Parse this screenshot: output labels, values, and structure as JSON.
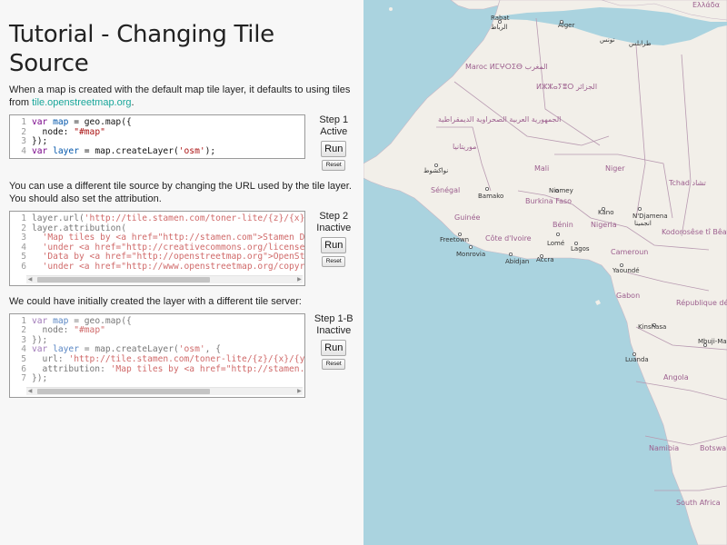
{
  "tutorial": {
    "title": "Tutorial - Changing Tile Source",
    "intro_text": "When a map is created with the default map tile layer, it defaults to using tiles from ",
    "intro_link": "tile.openstreetmap.org",
    "intro_end": ".",
    "step2_text": "You can use a different tile source by changing the URL used by the tile layer. You should also set the attribution.",
    "step1b_text": "We could have initially created the layer with a different tile server:"
  },
  "steps": [
    {
      "label": "Step 1",
      "status": "Active",
      "run_label": "Run",
      "reset_label": "Reset",
      "code_lines": [
        "var map = geo.map({",
        "  node: \"#map\"",
        "});",
        "var layer = map.createLayer('osm');"
      ]
    },
    {
      "label": "Step 2",
      "status": "Inactive",
      "run_label": "Run",
      "reset_label": "Reset",
      "code_lines": [
        "layer.url('http://tile.stamen.com/toner-lite/{z}/{x}/{y}.",
        "layer.attribution(",
        "  'Map tiles by <a href=\"http://stamen.com\">Stamen Design",
        "  'under <a href=\"http://creativecommons.org/licenses/by/",
        "  'Data by <a href=\"http://openstreetmap.org\">OpenStreetM",
        "  'under <a href=\"http://www.openstreetmap.org/copyright\""
      ]
    },
    {
      "label": "Step 1-B",
      "status": "Inactive",
      "run_label": "Run",
      "reset_label": "Reset",
      "code_lines": [
        "var map = geo.map({",
        "  node: \"#map\"",
        "});",
        "var layer = map.createLayer('osm', {",
        "  url: 'http://tile.stamen.com/toner-lite/{z}/{x}/{y}.png",
        "  attribution: 'Map tiles by <a href=\"http://stamen.com\">",
        "});"
      ]
    }
  ],
  "map": {
    "countries": [
      "Ελλάδα",
      "Maroc ⵍⵎⵖⵔⵉⴱ المغرب",
      "ⵍⵣⵣⴰⵢⴻⵔ الجزائر",
      "الجمهورية العربية الصحراوية الديمقراطية",
      "موريتانيا",
      "Mali",
      "Niger",
      "Tchad تشاد",
      "Sénégal",
      "Burkina Faso",
      "Guinée",
      "Bénin",
      "Nigeria",
      "Côte d'Ivoire",
      "Cameroun",
      "Kodorosêse tî Bêafrîka - République Centrafricaine",
      "Gabon",
      "République démocratique du Congo",
      "Angola",
      "Namibia",
      "Botswa",
      "South Africa"
    ],
    "cities": [
      "Rabat",
      "الرباط",
      "Alger",
      "تونس",
      "طرابلس",
      "نواكشوط",
      "Bamako",
      "Niamey",
      "Kano",
      "N'Djamena",
      "انجمينا",
      "Freetown",
      "Monrovia",
      "Lomé",
      "Lagos",
      "Abidjan",
      "Accra",
      "Yaoundé",
      "Kinshasa",
      "Mbuji-Mayi",
      "Luanda"
    ]
  }
}
